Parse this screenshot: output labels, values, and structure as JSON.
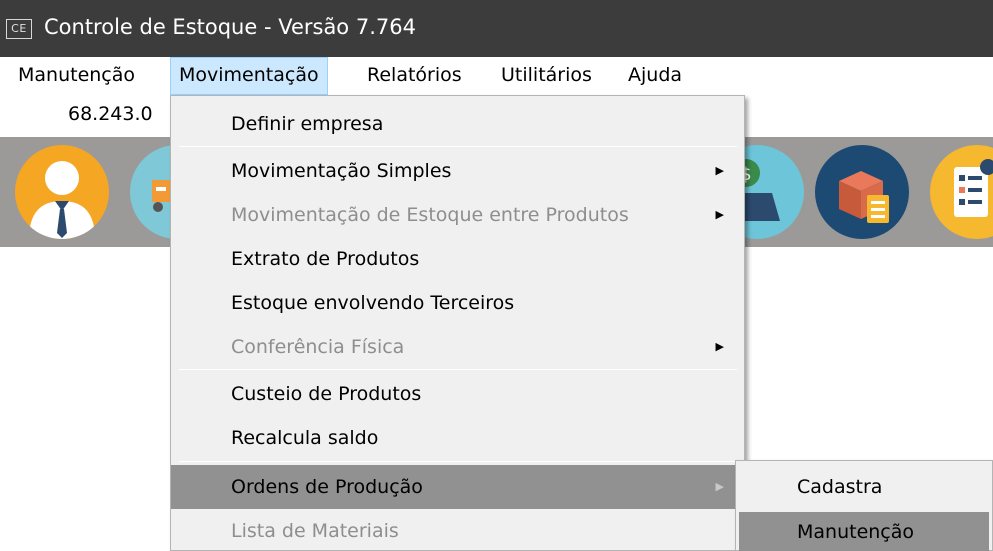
{
  "titlebar": {
    "app_icon_text": "CE",
    "title": "Controle de Estoque - Versão 7.764",
    "background": "#3c3c3c"
  },
  "menubar": {
    "items": [
      {
        "label": "Manutenção"
      },
      {
        "label": "Movimentação",
        "active": true
      },
      {
        "label": "Relatórios"
      },
      {
        "label": "Utilitários"
      },
      {
        "label": "Ajuda"
      }
    ]
  },
  "subrow": {
    "value": "68.243.0"
  },
  "toolbar_icons": [
    {
      "name": "user-icon",
      "color": "#f5a623"
    },
    {
      "name": "truck-icon",
      "color": "#7ec8d8"
    },
    {
      "name": "money-box-icon",
      "color": "#6cc5d8"
    },
    {
      "name": "box-clipboard-icon",
      "color": "#1c4a73"
    },
    {
      "name": "checklist-icon",
      "color": "#f5b82e"
    }
  ],
  "dropdown": {
    "items": [
      {
        "label": "Definir empresa"
      },
      {
        "label": "Movimentação Simples",
        "submenu": true
      },
      {
        "label": "Movimentação de Estoque entre Produtos",
        "submenu": true,
        "disabled": true
      },
      {
        "label": "Extrato de Produtos"
      },
      {
        "label": "Estoque envolvendo Terceiros"
      },
      {
        "label": "Conferência Física",
        "submenu": true,
        "disabled": true
      },
      {
        "label": "Custeio de Produtos"
      },
      {
        "label": "Recalcula saldo"
      },
      {
        "label": "Ordens de Produção",
        "submenu": true,
        "highlighted": true
      },
      {
        "label": "Lista de Materiais",
        "disabled": true
      }
    ],
    "arrow_glyph": "▶"
  },
  "submenu": {
    "items": [
      {
        "label": "Cadastra"
      },
      {
        "label": "Manutenção",
        "highlighted": true
      }
    ]
  },
  "colors": {
    "highlight": "#919191",
    "menu_bg": "#f0f0f0",
    "active_menu_bg": "#cce8ff",
    "toolbar_bg": "#9b9a98"
  }
}
